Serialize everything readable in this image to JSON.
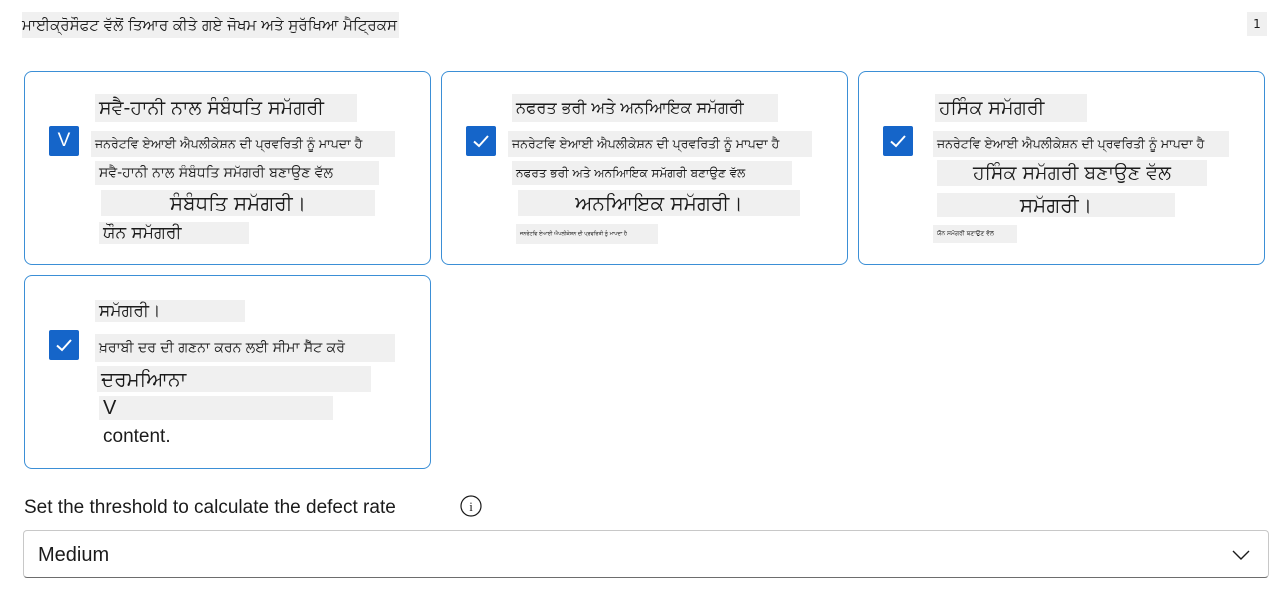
{
  "header": {
    "title": "ਮਾਈਕ੍ਰੋਸੌਫਟ ਵੱਲੋਂ ਤਿਆਰ ਕੀਤੇ ਗਏ ਜੋਖਮ ਅਤੇ ਸੁਰੱਖਿਆ ਮੈਟ੍ਰਿਕਸ",
    "count": "1"
  },
  "cards": [
    {
      "checked": true,
      "checkbox_glyph": "V",
      "lines": [
        "ਸਵੈ-ਹਾਨੀ ਨਾਲ ਸੰਬੰਧਤਿ ਸਮੱਗਰੀ",
        "ਜਨਰੇਟਵਿ ਏਆਈ ਐਪਲੀਕੇਸ਼ਨ ਦੀ ਪ੍ਰਵਰਿਤੀ ਨੂੰ ਮਾਪਦਾ ਹੈ",
        "ਸਵੈ-ਹਾਨੀ ਨਾਲ ਸੰਬੰਧਤਿ ਸਮੱਗਰੀ ਬਣਾਉਣ ਵੱਲ",
        "ਸੰਬੰਧਤਿ ਸਮੱਗਰੀ।",
        "ਯੌਨ ਸਮੱਗਰੀ"
      ]
    },
    {
      "checked": true,
      "lines": [
        "ਨਫਰਤ ਭਰੀ ਅਤੇ ਅਨਆਿਇਕ ਸਮੱਗਰੀ",
        "ਜਨਰੇਟਵਿ ਏਆਈ ਐਪਲੀਕੇਸ਼ਨ ਦੀ ਪ੍ਰਵਰਿਤੀ ਨੂੰ ਮਾਪਦਾ ਹੈ",
        "ਨਫਰਤ ਭਰੀ ਅਤੇ ਅਨਆਿਇਕ ਸਮੱਗਰੀ ਬਣਾਉਣ ਵੱਲ",
        "ਅਨਆਿਇਕ ਸਮੱਗਰੀ।",
        "ਜਨਰੇਟਵਿ ਏਆਈ ਐਪਲੀਕੇਸ਼ਨ ਦੀ ਪ੍ਰਵਰਿਤੀ ਨੂੰ ਮਾਪਦਾ ਹੈ"
      ]
    },
    {
      "checked": true,
      "lines": [
        "ਹਸਿੰਕ ਸਮੱਗਰੀ",
        "ਜਨਰੇਟਵਿ ਏਆਈ ਐਪਲੀਕੇਸ਼ਨ ਦੀ ਪ੍ਰਵਰਿਤੀ ਨੂੰ ਮਾਪਦਾ ਹੈ",
        "ਹਸਿੰਕ ਸਮੱਗਰੀ ਬਣਾਉਣ ਵੱਲ",
        "ਸਮੱਗਰੀ।",
        "ਯੌਨ ਸਮੱਗਰੀ ਬਣਾਉਣ ਵੱਲ"
      ]
    },
    {
      "checked": true,
      "lines": [
        "ਸਮੱਗਰੀ।",
        "ਖ਼ਰਾਬੀ ਦਰ ਦੀ ਗਣਨਾ ਕਰਨ ਲਈ ਸੀਮਾ ਸੈੱਟ ਕਰੋ",
        "ਦਰਮਆਿਨਾ",
        "V",
        "content."
      ]
    }
  ],
  "threshold": {
    "label": "Set the threshold to calculate the defect rate",
    "info_glyph": "i",
    "selected": "Medium"
  },
  "colors": {
    "accent": "#1565c9",
    "card_border": "#3b8fd6"
  }
}
